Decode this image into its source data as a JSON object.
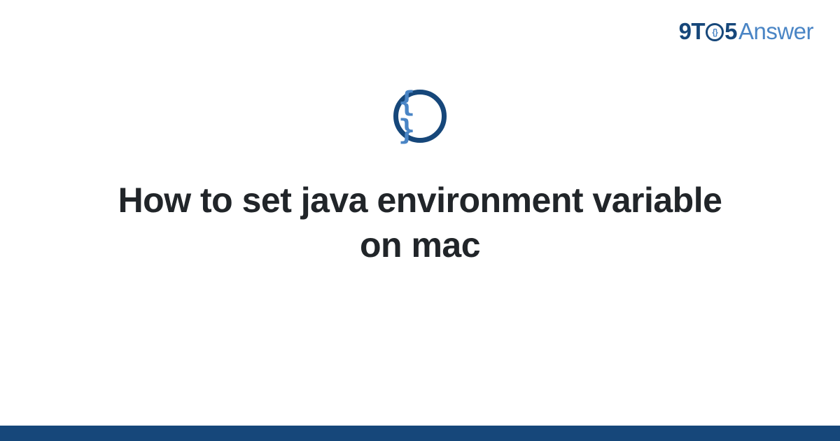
{
  "logo": {
    "part1": "9T",
    "o_inner": "{}",
    "part2": "5",
    "part3": "Answer"
  },
  "badge": {
    "glyph": "{ }"
  },
  "title": "How to set java environment variable on mac",
  "colors": {
    "dark_blue": "#16477a",
    "light_blue": "#4a85c5",
    "text": "#212529"
  }
}
